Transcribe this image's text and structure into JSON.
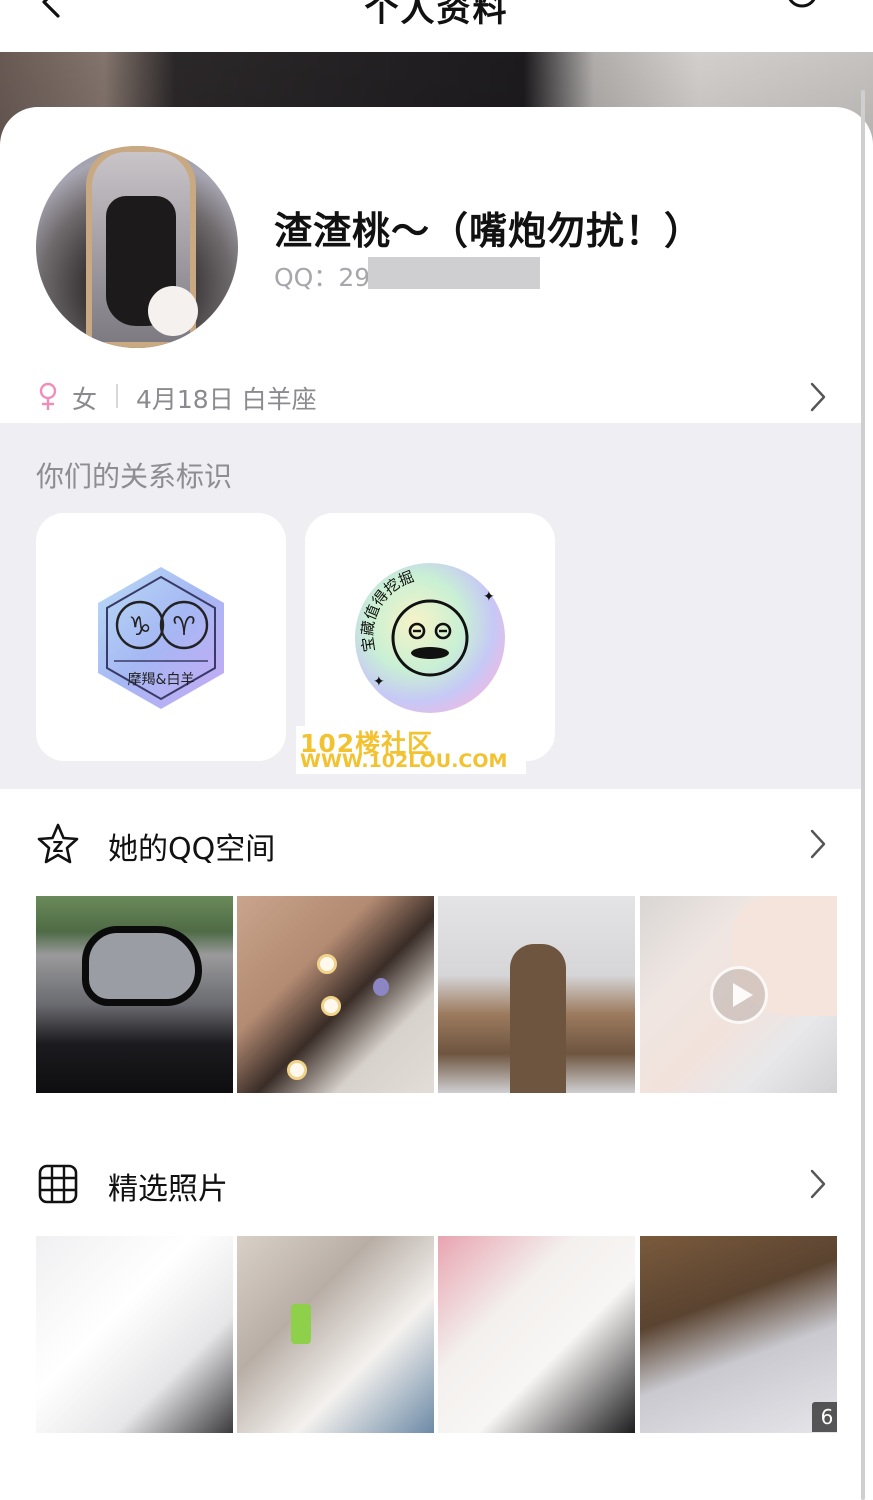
{
  "navbar": {
    "title": "个人资料"
  },
  "profile": {
    "nickname": "渣渣桃～（嘴炮勿扰！）",
    "qq_label": "QQ：29",
    "gender": "女",
    "birthday": "4月18日  白羊座"
  },
  "relation": {
    "title": "你们的关系标识",
    "badges": [
      {
        "label": "摩羯&白羊"
      },
      {
        "label": "宝藏值得挖掘"
      }
    ]
  },
  "watermark": {
    "line1": "102楼社区",
    "line2": "WWW.102LOU.COM"
  },
  "qzone": {
    "title": "她的QQ空间"
  },
  "photos": {
    "title": "精选照片",
    "more_count": "6"
  },
  "colors": {
    "gender_pink": "#f08dbb",
    "watermark_yellow": "#f2c230",
    "section_bg": "#efeff3"
  }
}
